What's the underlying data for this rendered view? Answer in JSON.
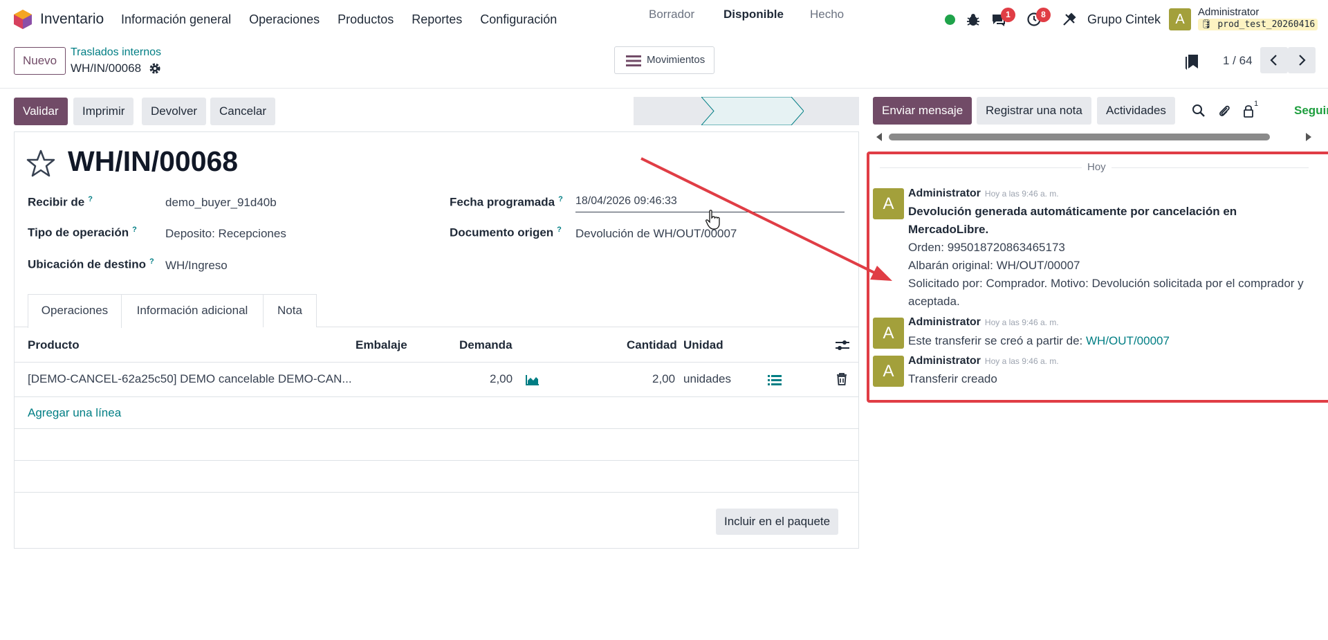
{
  "navbar": {
    "app_name": "Inventario",
    "menu": [
      "Información general",
      "Operaciones",
      "Productos",
      "Reportes",
      "Configuración"
    ],
    "chat_badge": "1",
    "activity_badge": "8",
    "company": "Grupo Cintek",
    "user_initial": "A",
    "user_name": "Administrator",
    "database": "prod_test_20260416"
  },
  "control": {
    "new_label": "Nuevo",
    "breadcrumb": "Traslados internos",
    "record": "WH/IN/00068",
    "movements_label": "Movimientos",
    "pager": "1 / 64"
  },
  "actions": {
    "validate": "Validar",
    "print": "Imprimir",
    "return": "Devolver",
    "cancel": "Cancelar"
  },
  "status": {
    "steps": [
      "Borrador",
      "Disponible",
      "Hecho"
    ],
    "active": "Disponible"
  },
  "form": {
    "title": "WH/IN/00068",
    "receive_from_label": "Recibir de",
    "receive_from": "demo_buyer_91d40b",
    "operation_type_label": "Tipo de operación",
    "operation_type": "Deposito: Recepciones",
    "destination_label": "Ubicación de destino",
    "destination": "WH/Ingreso",
    "scheduled_label": "Fecha programada",
    "scheduled": "18/04/2026 09:46:33",
    "origin_label": "Documento origen",
    "origin": "Devolución de WH/OUT/00007",
    "help_mark": "?"
  },
  "tabs": [
    "Operaciones",
    "Información adicional",
    "Nota"
  ],
  "table": {
    "headers": [
      "Producto",
      "Embalaje",
      "Demanda",
      "Cantidad",
      "Unidad"
    ],
    "rows": [
      {
        "product": "[DEMO-CANCEL-62a25c50] DEMO cancelable DEMO-CAN...",
        "demand": "2,00",
        "quantity": "2,00",
        "unit": "unidades"
      }
    ],
    "add_line": "Agregar una línea",
    "package_button": "Incluir en el paquete"
  },
  "chatter": {
    "send_message": "Enviar mensaje",
    "log_note": "Registrar una nota",
    "activities": "Actividades",
    "followers_count": "1",
    "follow": "Seguir",
    "day": "Hoy",
    "messages": [
      {
        "initial": "A",
        "author": "Administrator",
        "time": "Hoy a las 9:46 a. m.",
        "title": "Devolución generada automáticamente por cancelación en MercadoLibre.",
        "lines": [
          "Orden: 995018720863465173",
          "Albarán original: WH/OUT/00007",
          "Solicitado por: Comprador. Motivo: Devolución solicitada por el comprador y aceptada."
        ]
      },
      {
        "initial": "A",
        "author": "Administrator",
        "time": "Hoy a las 9:46 a. m.",
        "text": "Este transferir se creó a partir de:",
        "link": "WH/OUT/00007"
      },
      {
        "initial": "A",
        "author": "Administrator",
        "time": "Hoy a las 9:46 a. m.",
        "text": "Transferir creado"
      }
    ]
  },
  "colors": {
    "primary": "#714b67",
    "link": "#017e84",
    "highlight": "#e03d45",
    "avatar": "#a3a03b"
  }
}
